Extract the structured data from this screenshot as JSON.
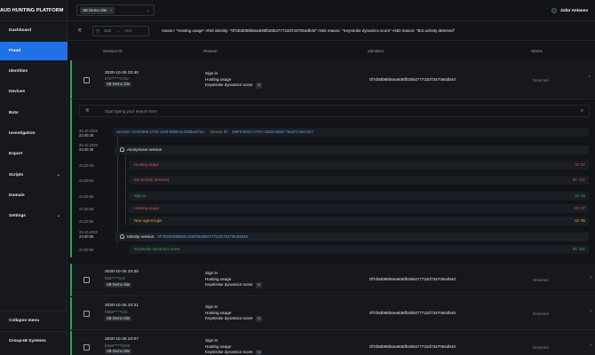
{
  "app": {
    "brand": "AUD HUNTING PLATFORM"
  },
  "sidebar": {
    "items": [
      {
        "label": "Dashboard"
      },
      {
        "label": "Fraud"
      },
      {
        "label": "Identities"
      },
      {
        "label": "Devices"
      },
      {
        "label": "Bots"
      },
      {
        "label": "Investigation"
      },
      {
        "label": "Export"
      },
      {
        "label": "Scripts"
      },
      {
        "label": "Domain"
      },
      {
        "label": "Settings"
      }
    ],
    "collapse_label": "Collapse menu",
    "company_label": "Group-IB Systems"
  },
  "topbar": {
    "site_chip": "SB Demo Site",
    "user_name": "Zafar Antanov"
  },
  "filter": {
    "date_start": "start",
    "date_arrow": "→",
    "date_end": "end",
    "query": "reason: \"Hosting usage\" AND identity: \"0f7d0d088b6ea936fb25b477722d7347064db40\" AND reason: \"Keystroke dynamics score\" AND reason: \"Bot activity detected\""
  },
  "table": {
    "headers": [
      "Session ID",
      "Reason",
      "Identities",
      "Status"
    ]
  },
  "rows": [
    {
      "date": "2020-10-25   23:40",
      "mask": "57ef*****47a4",
      "site": "SB Demo Site",
      "reasons": [
        "Sign in",
        "Hosting usage",
        "Keystroke dynamics score"
      ],
      "more": "+2",
      "identity": "0f7d0d088b6ea936fb25b477722d7347064db40",
      "status": "Detected"
    },
    {
      "date": "2020-10-25   23:35",
      "mask": "965*****ee2",
      "site": "SB Demo Site",
      "reasons": [
        "Sign in",
        "Hosting usage",
        "Keystroke dynamics score"
      ],
      "more": "+2",
      "identity": "0f7d0d088b6ea936fb25b477722d7347064db40",
      "status": "Detected"
    },
    {
      "date": "2020-10-25   23:31",
      "mask": "99b8*****ceb",
      "site": "SB Demo Site",
      "reasons": [
        "Sign in",
        "Hosting usage",
        "Keystroke dynamics score"
      ],
      "more": "+2",
      "identity": "0f7d0d088b6ea936fb25b477722d7347064db40",
      "status": "Detected"
    },
    {
      "date": "2020-10-25   23:07",
      "mask": "b5a8*****902b",
      "site": "SB Demo Site",
      "reasons": [
        "Sign in",
        "Hosting usage",
        "Keystroke dynamics score"
      ],
      "more": "+2",
      "identity": "0f7d0d088b6ea936fb25b477722d7347064db40",
      "status": "Detected"
    }
  ],
  "detail": {
    "search_placeholder": "Start typing your search term",
    "session_date": "25.10.2020",
    "session_time": "23:40:29",
    "session_label": "Session: 57efc566-1702-11eb-85b9-ac1f6bbe67a4",
    "device_label": "Device ID:",
    "device_id": "D5FE4E5C-CF57-4DD6-9025-7641FC4EC547",
    "anon_date": "25.10.2020",
    "anon_time": "23:40:29",
    "anon_label": "Anonymous session",
    "anon_events": [
      {
        "time": "23:40:29",
        "label": "Hosting usage",
        "id": "ID: 57",
        "color": "red"
      },
      {
        "time": "23:40:54",
        "label": "Bot activity detected",
        "id": "ID: 137",
        "color": "red"
      },
      {
        "time": "23:40:58",
        "label": "Sign in",
        "id": "ID: 46",
        "color": "green"
      },
      {
        "time": "23:40:58",
        "label": "Hosting usage",
        "id": "ID: 57",
        "color": "red"
      },
      {
        "time": "23:40:58",
        "label": "New agent login",
        "id": "ID: 95",
        "color": "amber"
      }
    ],
    "ident_date": "25.10.2020",
    "ident_time": "23:40:58",
    "ident_label": "Identity session:",
    "ident_id": "0F7D0D088B6EA936FB25B477722D7347064DB40",
    "ident_events": [
      {
        "time": "23:40:58",
        "label": "Keystroke dynamics score",
        "id": "ID: 151",
        "color": "green"
      }
    ]
  }
}
